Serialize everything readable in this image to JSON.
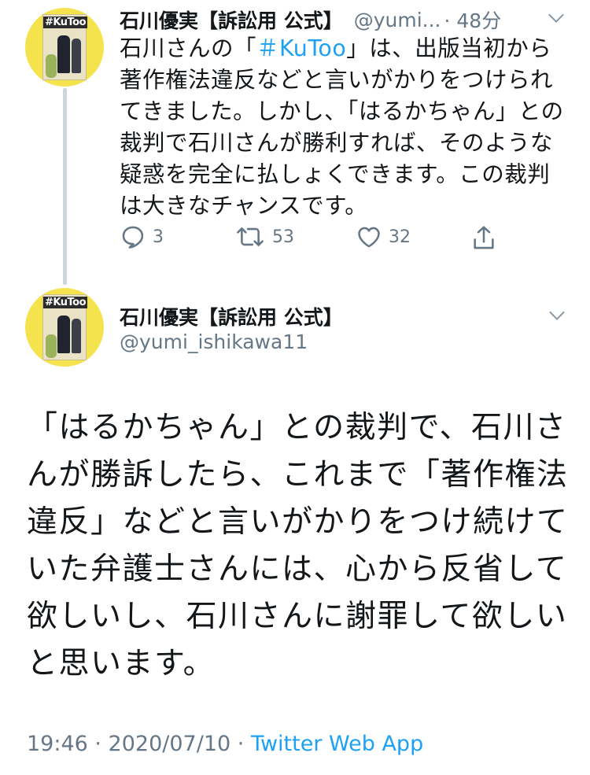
{
  "tweet1": {
    "name": "石川優実【訴訟用 公式】",
    "handle": "@yumi...",
    "time": "· 48分",
    "text_before": "石川さんの「",
    "hashtag": "＃KuToo",
    "text_after": "」は、出版当初から著作権法違反などと言いがかりをつけられてきました。しかし、「はるかちゃん」との裁判で石川さんが勝利すれば、そのような疑惑を完全に払しょくできます。この裁判は大きなチャンスです。",
    "reply_count": "3",
    "retweet_count": "53",
    "like_count": "32"
  },
  "tweet2": {
    "name": "石川優実【訴訟用 公式】",
    "handle": "@yumi_ishikawa11",
    "text": "「はるかちゃん」との裁判で、石川さんが勝訴したら、これまで「著作権法違反」などと言いがかりをつけ続けていた弁護士さんには、心から反省して欲しいし、石川さんに謝罪して欲しいと思います。",
    "timestamp": "19:46 · 2020/07/10 · ",
    "source": "Twitter Web App"
  },
  "avatar": {
    "cover_title": "#KuToo"
  },
  "colors": {
    "accent": "#1da1f2",
    "secondary_text": "#657786",
    "avatar_bg": "#f5e34d"
  },
  "icons": [
    "reply-icon",
    "retweet-icon",
    "like-icon",
    "share-icon",
    "chevron-down-icon"
  ]
}
